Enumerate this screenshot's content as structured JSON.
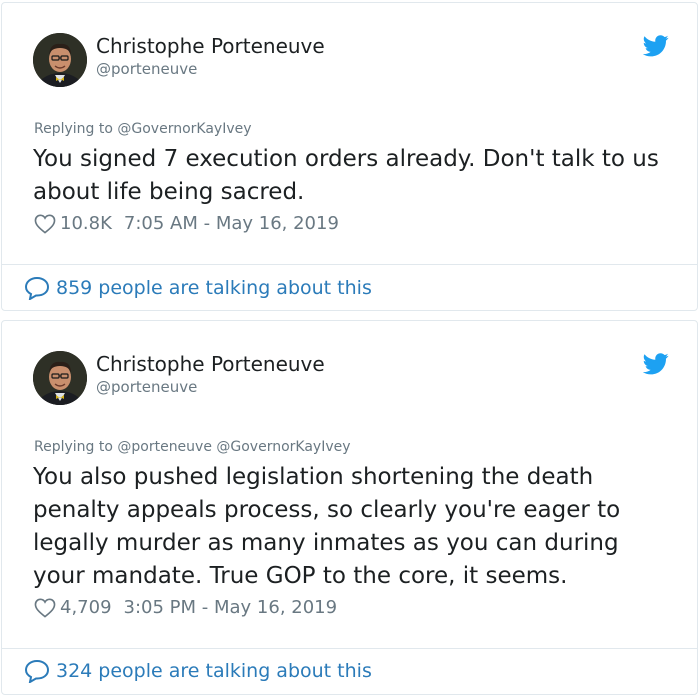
{
  "colors": {
    "text": "#1c2022",
    "muted": "#697882",
    "link": "#2b7bb9",
    "twitter_blue": "#1da1f2",
    "border": "#e1e8ed"
  },
  "tweets": [
    {
      "author_name": "Christophe Porteneuve",
      "author_handle": "@porteneuve",
      "replying_to": "Replying to @GovernorKayIvey",
      "text": "You signed 7 execution orders already. Don't talk to us about life being sacred.",
      "likes": "10.8K",
      "timestamp": "7:05 AM - May 16, 2019",
      "talking": "859 people are talking about this",
      "icons": {
        "avatar": "avatar-photo",
        "bird": "twitter-bird-icon",
        "heart": "heart-icon",
        "bubble": "speech-bubble-icon"
      }
    },
    {
      "author_name": "Christophe Porteneuve",
      "author_handle": "@porteneuve",
      "replying_to": "Replying to @porteneuve @GovernorKayIvey",
      "text": "You also pushed legislation shortening the death penalty appeals process, so clearly you're eager to legally murder as many inmates as you can during your mandate. True GOP to the core, it seems.",
      "likes": "4,709",
      "timestamp": "3:05 PM - May 16, 2019",
      "talking": "324 people are talking about this",
      "icons": {
        "avatar": "avatar-photo",
        "bird": "twitter-bird-icon",
        "heart": "heart-icon",
        "bubble": "speech-bubble-icon"
      }
    }
  ]
}
